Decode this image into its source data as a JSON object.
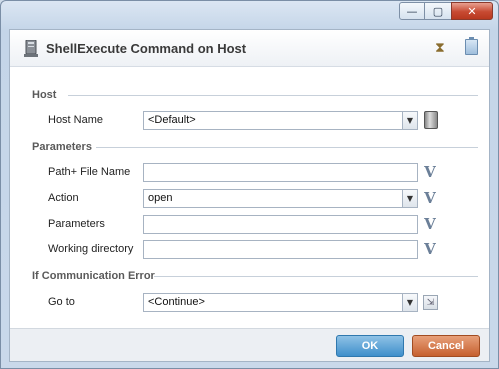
{
  "window": {
    "buttons": {
      "minimize": "—",
      "maximize": "▢",
      "close": "✕"
    }
  },
  "header": {
    "title": "ShellExecute Command on Host",
    "icons": [
      "host-icon",
      "hourglass-icon",
      "clipboard-icon"
    ]
  },
  "sections": {
    "host": "Host",
    "parameters": "Parameters",
    "comm_error": "If Communication Error"
  },
  "fields": {
    "host_name": {
      "label": "Host Name",
      "value": "<Default>"
    },
    "path_file": {
      "label": "Path+ File Name",
      "value": ""
    },
    "action": {
      "label": "Action",
      "value": "open"
    },
    "parameters": {
      "label": "Parameters",
      "value": ""
    },
    "working_dir": {
      "label": "Working directory",
      "value": ""
    },
    "goto": {
      "label": "Go to",
      "value": "<Continue>"
    }
  },
  "variable_button": "V",
  "dropdown_arrow": "▼",
  "goto_arrow": "⇲",
  "footer": {
    "ok": "OK",
    "cancel": "Cancel"
  },
  "colors": {
    "ok": "#3f8fcb",
    "cancel": "#c6602f",
    "close": "#c74a32"
  }
}
